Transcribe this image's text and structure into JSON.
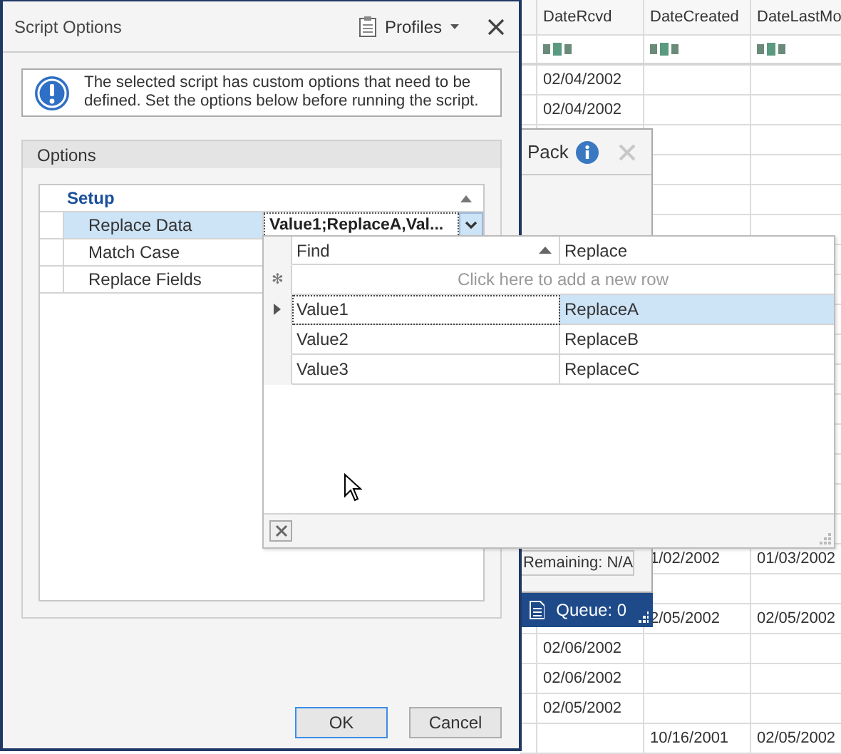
{
  "background_grid": {
    "columns": [
      {
        "label": "DateRcvd"
      },
      {
        "label": "DateCreated"
      },
      {
        "label": "DateLastMo"
      }
    ],
    "rows": [
      {
        "cells": [
          "02/04/2002",
          null,
          null
        ]
      },
      {
        "cells": [
          "02/04/2002",
          null,
          null
        ]
      },
      {
        "cells": [
          null,
          null,
          null
        ]
      },
      {
        "cells": [
          null,
          null,
          null
        ]
      },
      {
        "cells": [
          null,
          null,
          null
        ]
      },
      {
        "cells": [
          null,
          null,
          null
        ]
      },
      {
        "cells": [
          null,
          null,
          null
        ]
      },
      {
        "cells": [
          null,
          null,
          null
        ]
      },
      {
        "cells": [
          null,
          null,
          null
        ]
      },
      {
        "cells": [
          null,
          null,
          null
        ]
      },
      {
        "cells": [
          null,
          null,
          null
        ]
      },
      {
        "cells": [
          null,
          null,
          null
        ]
      },
      {
        "cells": [
          null,
          null,
          null
        ]
      },
      {
        "cells": [
          null,
          null,
          null
        ]
      },
      {
        "cells": [
          null,
          null,
          null
        ]
      },
      {
        "cells": [
          null,
          null,
          null
        ]
      },
      {
        "cells": [
          null,
          "1/02/2002",
          "01/03/2002"
        ]
      },
      {
        "cells": [
          null,
          null,
          null
        ]
      },
      {
        "cells": [
          null,
          "2/05/2002",
          "02/05/2002"
        ]
      },
      {
        "cells": [
          "02/06/2002",
          null,
          null
        ]
      },
      {
        "cells": [
          "02/06/2002",
          null,
          null
        ]
      },
      {
        "cells": [
          "02/05/2002",
          null,
          null
        ]
      },
      {
        "cells": [
          null,
          "10/16/2001",
          "02/05/2002"
        ]
      }
    ]
  },
  "pack_panel": {
    "title": "Pack",
    "remaining": "Remaining: N/A"
  },
  "queue_bar": {
    "label": "Queue: 0"
  },
  "dialog": {
    "title": "Script Options",
    "profiles_label": "Profiles",
    "message": "The selected script has custom options that need to be defined. Set the options below before running the script.",
    "group_title": "Options",
    "category": {
      "label": "Setup",
      "expanded": true,
      "properties": [
        {
          "name": "Replace Data",
          "value": "Value1;ReplaceA,Val...",
          "selected": true
        },
        {
          "name": "Match Case",
          "selected": false
        },
        {
          "name": "Replace Fields",
          "selected": false
        }
      ]
    },
    "buttons": [
      {
        "label": "OK",
        "default": true
      },
      {
        "label": "Cancel",
        "default": false
      }
    ]
  },
  "popup": {
    "columns": [
      {
        "label": "Find",
        "sorted": true
      },
      {
        "label": "Replace",
        "sorted": false
      }
    ],
    "new_row_marker": "✻",
    "new_row_hint": "Click here to add a new row",
    "rows": [
      {
        "find": "Value1",
        "replace": "ReplaceA",
        "selected": true
      },
      {
        "find": "Value2",
        "replace": "ReplaceB",
        "selected": false
      },
      {
        "find": "Value3",
        "replace": "ReplaceC",
        "selected": false
      }
    ]
  }
}
